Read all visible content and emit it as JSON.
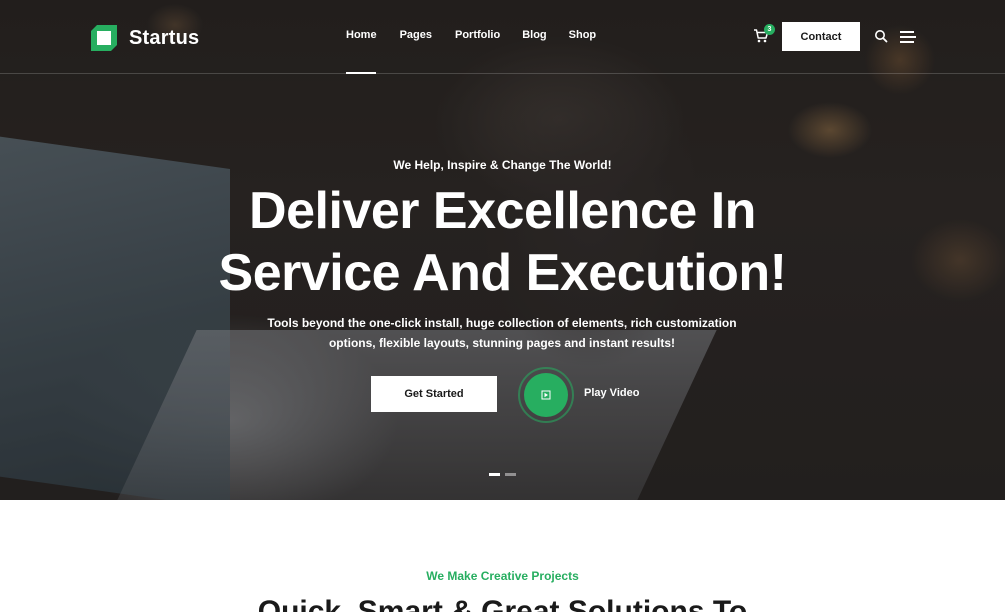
{
  "brand": {
    "name": "Startus",
    "accent_color": "#27ae60"
  },
  "nav": {
    "items": [
      {
        "label": "Home",
        "active": true
      },
      {
        "label": "Pages"
      },
      {
        "label": "Portfolio"
      },
      {
        "label": "Blog"
      },
      {
        "label": "Shop"
      }
    ]
  },
  "header_actions": {
    "cart_icon": "cart-icon",
    "cart_count": "3",
    "contact_label": "Contact",
    "search_icon": "search-icon",
    "menu_icon": "hamburger-menu-icon"
  },
  "hero": {
    "tagline": "We Help, Inspire & Change The World!",
    "headline_line1": "Deliver Excellence In",
    "headline_line2": "Service And Execution!",
    "subtext_line1": "Tools beyond the one-click install, huge collection of elements, rich customization",
    "subtext_line2": "options, flexible layouts, stunning pages and instant results!",
    "cta_label": "Get Started",
    "play_label": "Play Video",
    "slide_count": 2,
    "active_slide": 1
  },
  "section": {
    "kicker": "We Make Creative Projects",
    "title": "Quick, Smart & Great Solutions To"
  }
}
